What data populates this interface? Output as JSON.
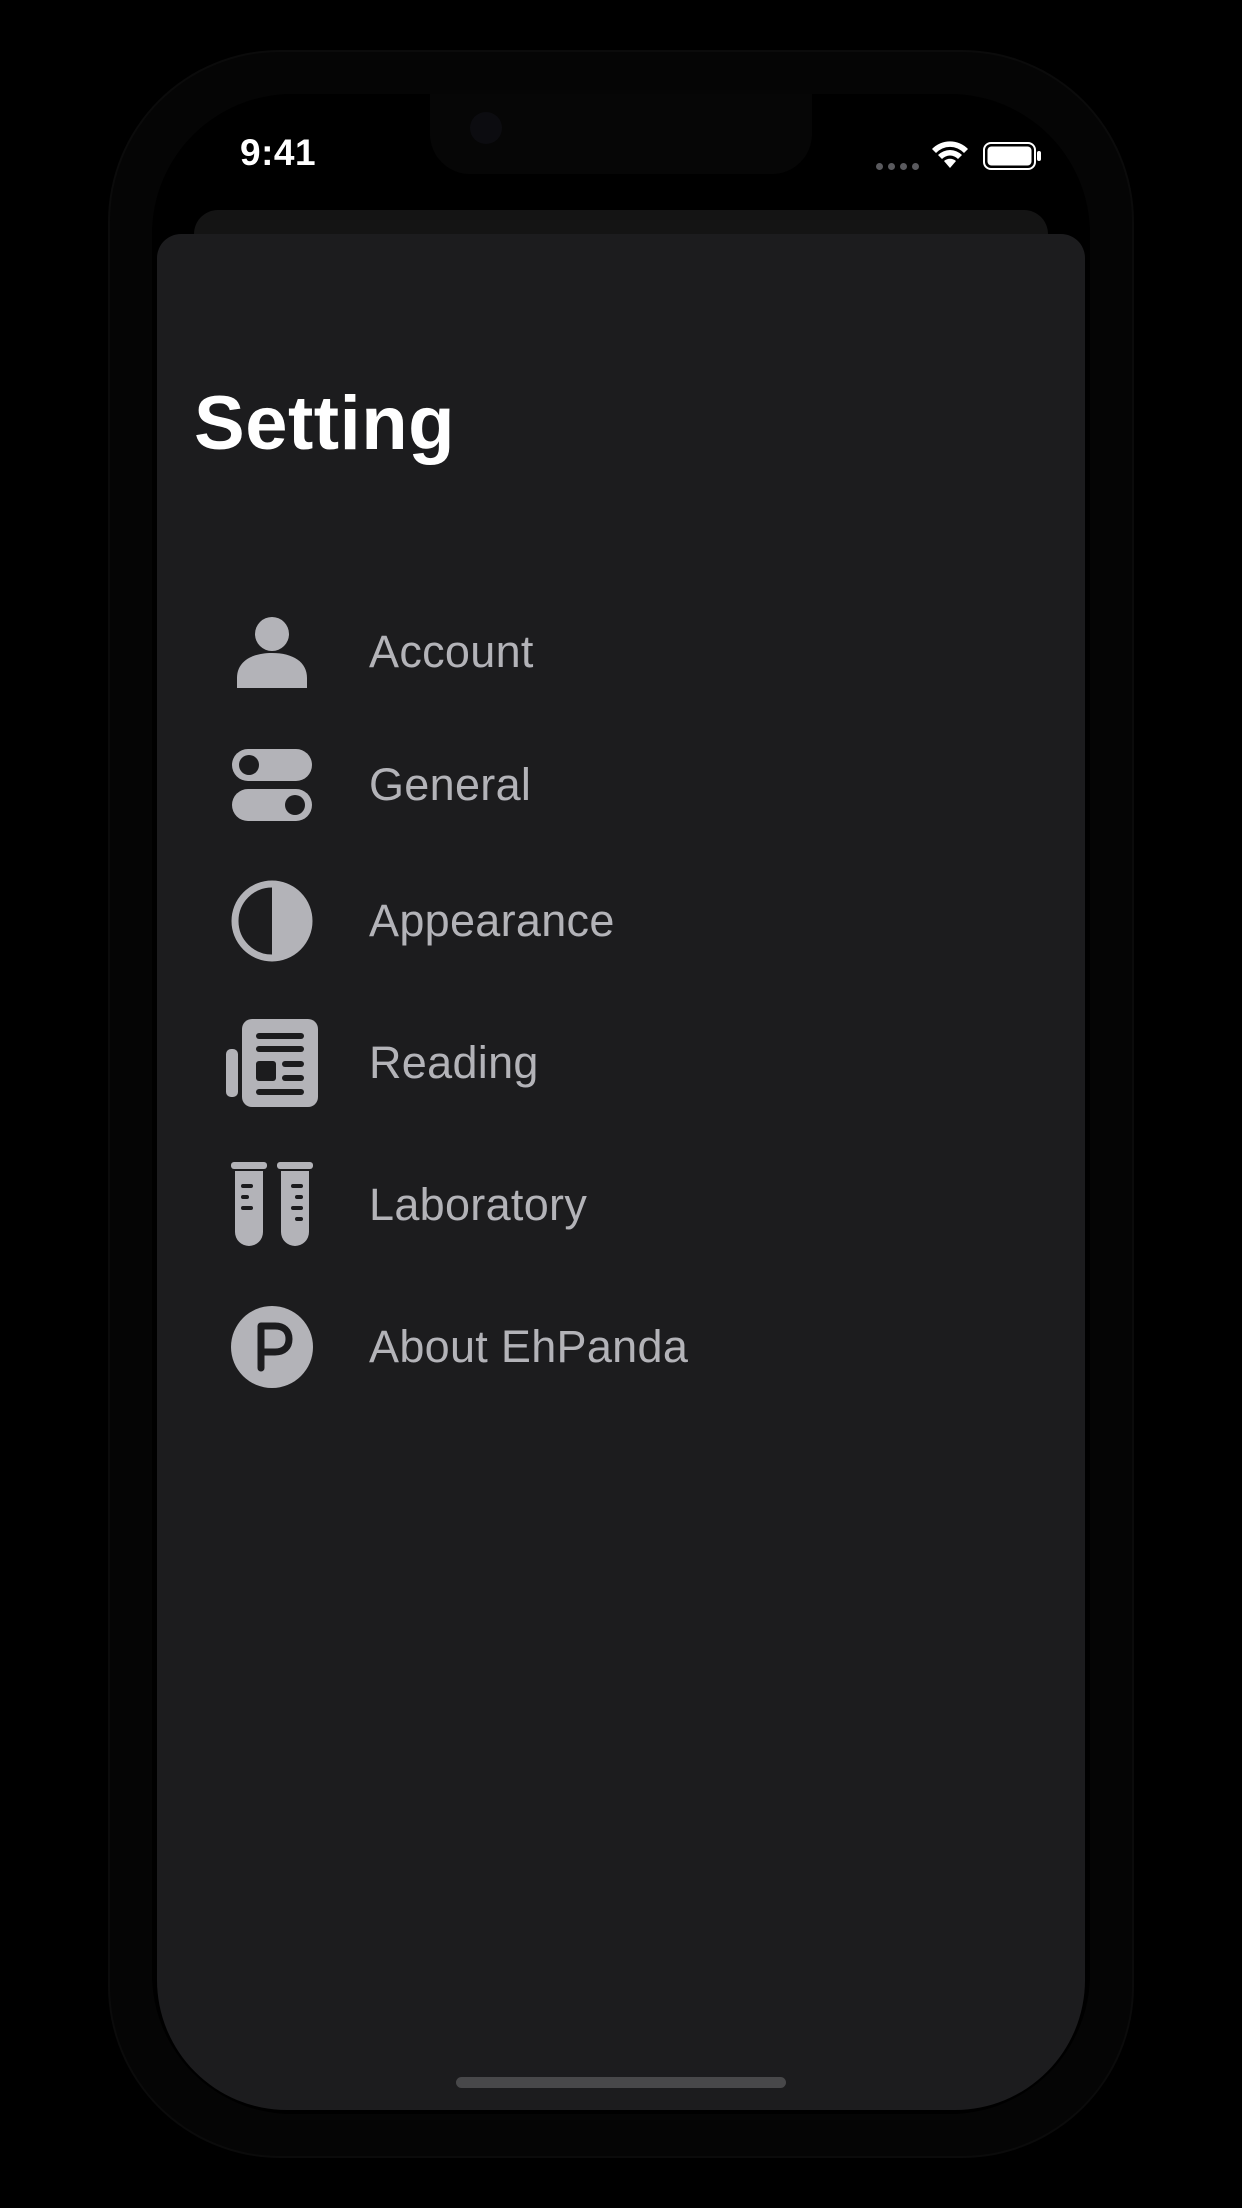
{
  "status_bar": {
    "time": "9:41",
    "icons": [
      "cellular-icon",
      "wifi-icon",
      "battery-icon"
    ]
  },
  "header": {
    "title": "Setting"
  },
  "menu": {
    "items": [
      {
        "label": "Account",
        "icon": "person-icon"
      },
      {
        "label": "General",
        "icon": "switches-icon"
      },
      {
        "label": "Appearance",
        "icon": "circle-half-icon"
      },
      {
        "label": "Reading",
        "icon": "newspaper-icon"
      },
      {
        "label": "Laboratory",
        "icon": "test-tubes-icon"
      },
      {
        "label": "About EhPanda",
        "icon": "p-circle-icon"
      }
    ]
  },
  "colors": {
    "background": "#000000",
    "sheet": "#1c1c1e",
    "title": "#ffffff",
    "label": "#b3b3b8",
    "icon": "#b3b3b8"
  }
}
